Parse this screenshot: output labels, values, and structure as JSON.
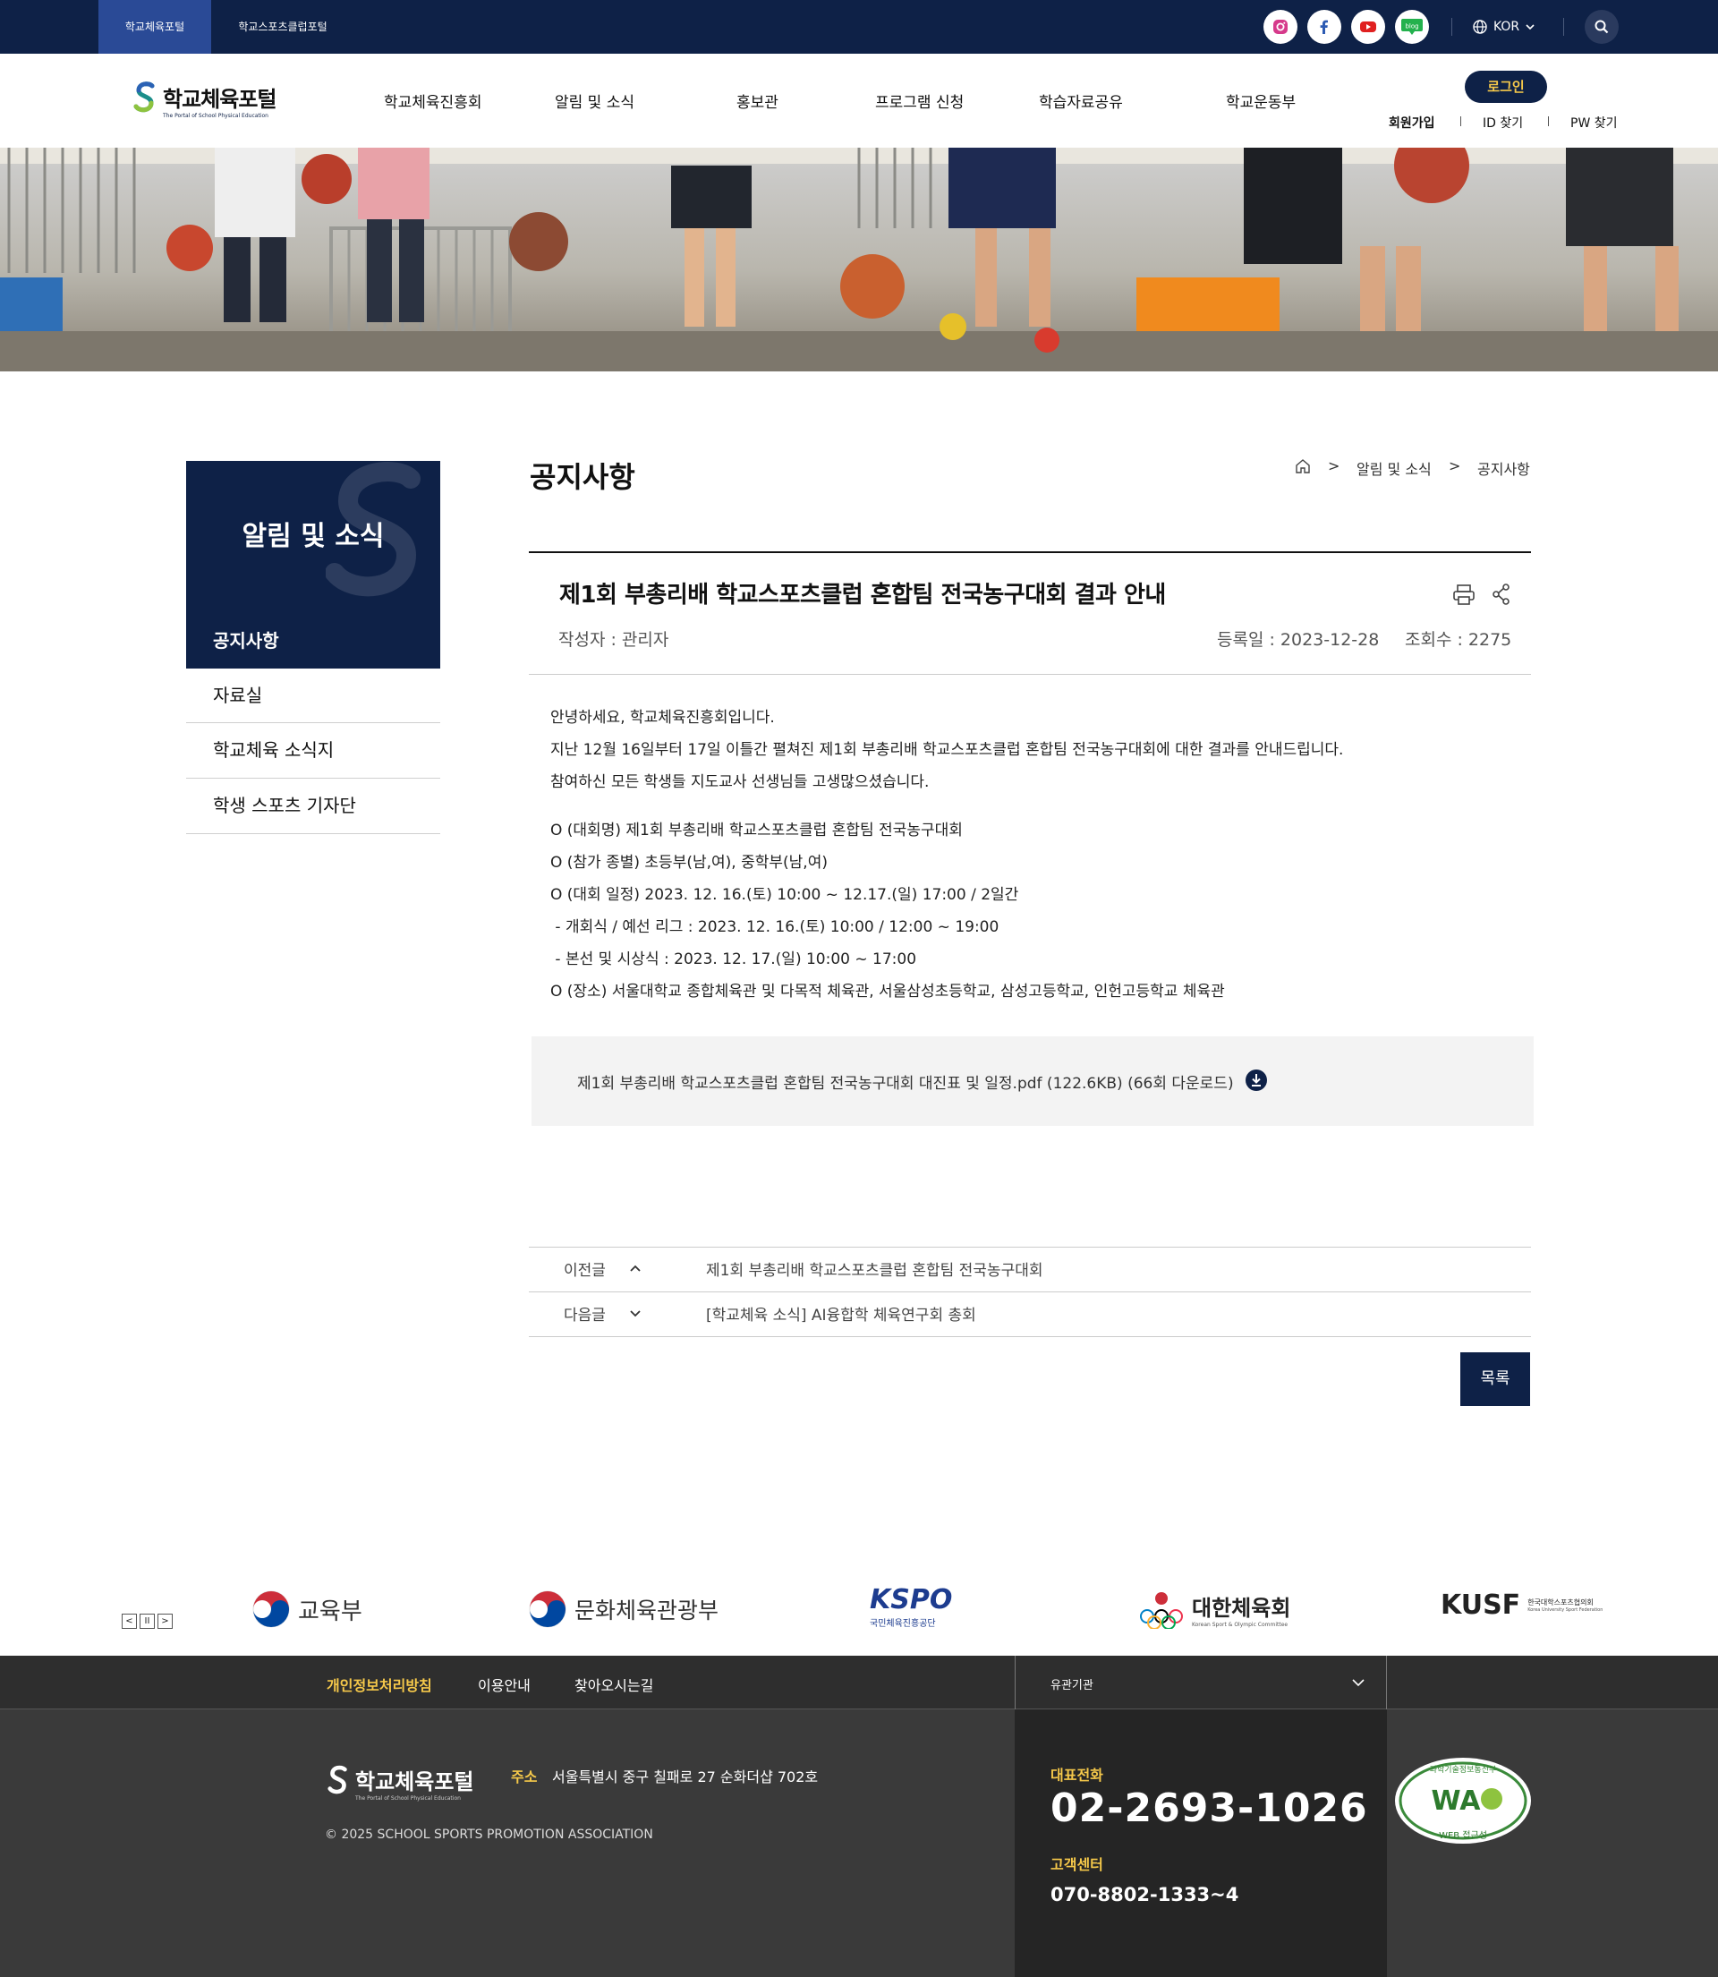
{
  "topbar": {
    "tabs": [
      "학교체육포털",
      "학교스포츠클럽포털"
    ],
    "sns": [
      "instagram-icon",
      "facebook-icon",
      "youtube-icon",
      "blog-icon"
    ],
    "blog_label": "blog",
    "lang": "KOR"
  },
  "header": {
    "logo_name": "학교체육포털",
    "logo_sub": "The Portal of School Physical Education",
    "nav": [
      "학교체육진흥회",
      "알림 및 소식",
      "홍보관",
      "프로그램 신청",
      "학습자료공유",
      "학교운동부"
    ],
    "login": "로그인",
    "member_links": [
      "회원가입",
      "ID 찾기",
      "PW 찾기"
    ]
  },
  "sidebar": {
    "title": "알림 및 소식",
    "items": [
      "공지사항",
      "자료실",
      "학교체육 소식지",
      "학생 스포츠 기자단"
    ]
  },
  "content": {
    "page_title": "공지사항",
    "breadcrumb": [
      "알림 및 소식",
      "공지사항"
    ],
    "breadcrumb_sep": ">",
    "post": {
      "title": "제1회 부총리배 학교스포츠클럽 혼합팀 전국농구대회 결과 안내",
      "author": "작성자 : 관리자",
      "date": "등록일 : 2023-12-28",
      "views": "조회수 : 2275",
      "body": [
        "안녕하세요, 학교체육진흥회입니다.",
        "지난 12월 16일부터 17일 이틀간 펼쳐진 제1회 부총리배 학교스포츠클럽 혼합팀 전국농구대회에 대한 결과를 안내드립니다.",
        "참여하신 모든 학생들 지도교사 선생님들 고생많으셨습니다.",
        "O (대회명) 제1회 부총리배 학교스포츠클럽 혼합팀 전국농구대회",
        "O (참가 종별) 초등부(남,여), 중학부(남,여)",
        "O (대회 일정) 2023. 12. 16.(토) 10:00 ~ 12.17.(일) 17:00 / 2일간",
        " - 개회식 / 예선 리그 : 2023. 12. 16.(토) 10:00 / 12:00 ~ 19:00",
        " - 본선 및 시상식 : 2023. 12. 17.(일) 10:00 ~ 17:00",
        "O (장소) 서울대학교 종합체육관 및 다목적 체육관, 서울삼성초등학교, 삼성고등학교, 인헌고등학교 체육관"
      ],
      "attachment": "제1회 부총리배 학교스포츠클럽 혼합팀 전국농구대회 대진표 및 일정.pdf (122.6KB) (66회 다운로드)"
    },
    "prev": {
      "label": "이전글",
      "title": "제1회 부총리배 학교스포츠클럽 혼합팀 전국농구대회"
    },
    "next": {
      "label": "다음글",
      "title": "[학교체육 소식] AI융합학 체육연구회 총회"
    },
    "list_button": "목록"
  },
  "partners": {
    "controls": [
      "<",
      "II",
      ">"
    ],
    "logos": [
      "교육부",
      "문화체육관광부",
      "KSPO",
      "국민체육진흥공단",
      "대한체육회",
      "Korean Sport & Olympic Committee",
      "KUSF",
      "한국대학스포츠협의회",
      "Korea University Sport Federation"
    ]
  },
  "footer": {
    "links": [
      "개인정보처리방침",
      "이용안내",
      "찾아오시는길"
    ],
    "related": "유관기관",
    "logo_name": "학교체육포털",
    "logo_sub": "The Portal of School Physical Education",
    "address_label": "주소",
    "address": "서울특별시 중구 칠패로 27 순화더샵 702호",
    "copyright": "© 2025 SCHOOL SPORTS PROMOTION ASSOCIATION",
    "phone_label": "대표전화",
    "phone": "02-2693-1026",
    "cs_label": "고객센터",
    "cs_phone": "070-8802-1333~4",
    "badge_text": [
      "WA",
      "과학기술정보통신부",
      "WEB 접근성"
    ]
  },
  "colors": {
    "navy": "#0e2147",
    "accent_yellow": "#f5c84a",
    "footer_dark": "#3a3a3a"
  }
}
